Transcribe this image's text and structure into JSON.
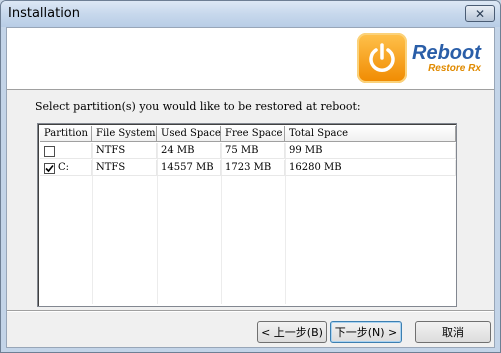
{
  "window": {
    "title": "Installation",
    "close_glyph": "✕"
  },
  "logo": {
    "main": "Reboot",
    "sub": "Restore Rx",
    "brand_color": "#f39c12"
  },
  "instruction": "Select partition(s) you would like to be restored at reboot:",
  "table": {
    "columns": [
      "Partition",
      "File System",
      "Used Space",
      "Free Space",
      "Total Space"
    ],
    "rows": [
      {
        "checked": false,
        "partition": "",
        "file_system": "NTFS",
        "used": "24 MB",
        "free": "75 MB",
        "total": "99 MB"
      },
      {
        "checked": true,
        "partition": "C:",
        "file_system": "NTFS",
        "used": "14557 MB",
        "free": "1723 MB",
        "total": "16280 MB"
      }
    ]
  },
  "buttons": {
    "back": "< 上一步(B)",
    "next": "下一步(N) >",
    "cancel": "取消"
  }
}
